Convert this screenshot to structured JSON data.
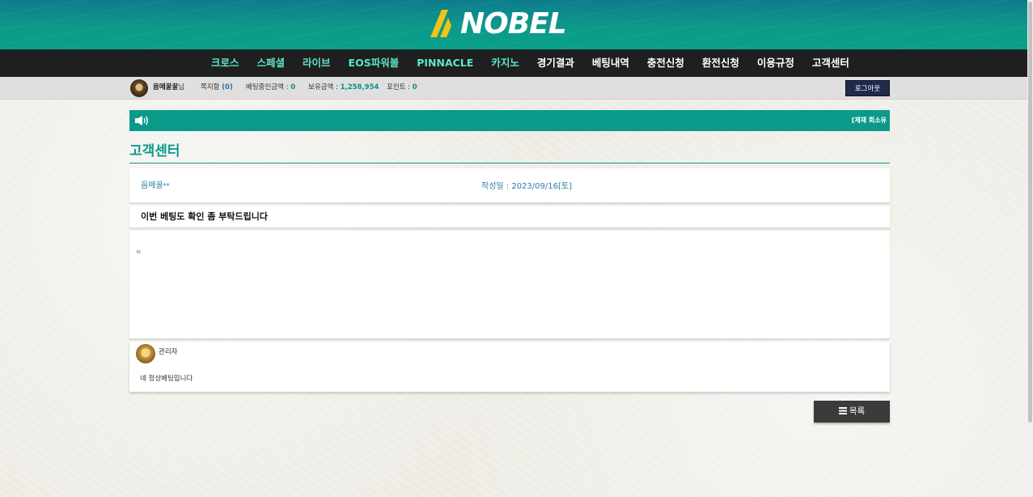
{
  "logo": {
    "text": "NOBEL"
  },
  "nav": {
    "items": [
      {
        "label": "크로스",
        "color": "green"
      },
      {
        "label": "스페셜",
        "color": "green"
      },
      {
        "label": "라이브",
        "color": "green"
      },
      {
        "label": "EOS파워볼",
        "color": "green"
      },
      {
        "label": "PINNACLE",
        "color": "green"
      },
      {
        "label": "카지노",
        "color": "green"
      },
      {
        "label": "경기결과",
        "color": "white"
      },
      {
        "label": "베팅내역",
        "color": "white"
      },
      {
        "label": "충전신청",
        "color": "white"
      },
      {
        "label": "환전신청",
        "color": "white"
      },
      {
        "label": "이용규정",
        "color": "white"
      },
      {
        "label": "고객센터",
        "color": "white"
      }
    ]
  },
  "user_bar": {
    "username": "음메꿀꿀",
    "suffix": "님",
    "messages_label": "쪽지함",
    "messages_count": "(0)",
    "betting_label": "베팅중인금액 :",
    "betting_value": "0",
    "holding_label": "보유금액 :",
    "holding_value": "1,258,954",
    "points_label": "포인트 :",
    "points_value": "0",
    "logout_label": "로그아웃"
  },
  "notice": {
    "text": "[제재 회소유"
  },
  "page_title": "고객센터",
  "post": {
    "author": "음메꿀",
    "author_mask": "**",
    "date": "작성일 : 2023/09/16[토]",
    "subject": "이번 베팅도 확인 좀 부탁드립니다",
    "body": "ㅂ"
  },
  "reply": {
    "name": "관리자",
    "text": "네 정상베팅입니다"
  },
  "list_button": {
    "icon": "list-icon",
    "label": "목록"
  },
  "colors": {
    "accent": "#0b9a8a",
    "nav_bg": "#1f1f1f",
    "link": "#2a7fa3"
  }
}
